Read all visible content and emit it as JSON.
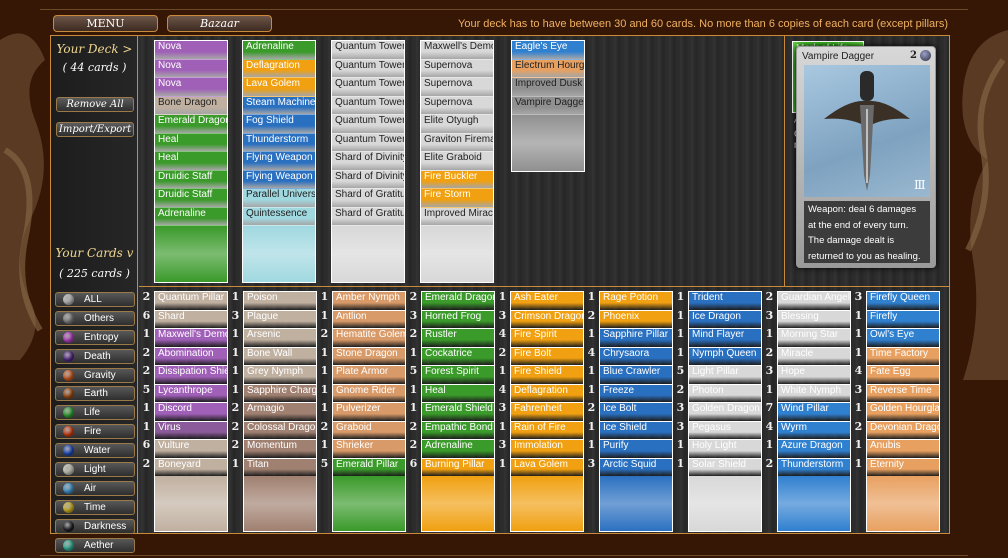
{
  "top": {
    "menu_label": "MENU",
    "bazaar_label": "Bazaar",
    "rules": "Your deck has to have between 30 and 60 cards. No more than 6 copies of each card (except pillars)"
  },
  "sidebar": {
    "deck_title": "Your Deck >",
    "deck_count": "( 44 cards )",
    "remove_all": "Remove All",
    "import_export": "Import/Export",
    "cards_title": "Your Cards v",
    "cards_count": "( 225 cards )",
    "filters": [
      {
        "label": "ALL",
        "icon": "all-icon",
        "color": "#c8c8c8"
      },
      {
        "label": "Others",
        "icon": "others-icon",
        "color": "#8a8a8a"
      },
      {
        "label": "Entropy",
        "icon": "entropy-icon",
        "color": "#c040d0"
      },
      {
        "label": "Death",
        "icon": "death-icon",
        "color": "#5a2a90"
      },
      {
        "label": "Gravity",
        "icon": "gravity-icon",
        "color": "#e06020"
      },
      {
        "label": "Earth",
        "icon": "earth-icon",
        "color": "#b05010"
      },
      {
        "label": "Life",
        "icon": "life-icon",
        "color": "#30b030"
      },
      {
        "label": "Fire",
        "icon": "fire-icon",
        "color": "#e04010"
      },
      {
        "label": "Water",
        "icon": "water-icon",
        "color": "#2050d0"
      },
      {
        "label": "Light",
        "icon": "light-icon",
        "color": "#d8d8c8"
      },
      {
        "label": "Air",
        "icon": "air-icon",
        "color": "#40a0e0"
      },
      {
        "label": "Time",
        "icon": "time-icon",
        "color": "#e0c020"
      },
      {
        "label": "Darkness",
        "icon": "darkness-icon",
        "color": "#202028"
      },
      {
        "label": "Aether",
        "icon": "aether-icon",
        "color": "#30c0a0"
      }
    ]
  },
  "element_colors": {
    "entropy": "#a060b8",
    "death": "#8a5a9a",
    "earth": "#d89a68",
    "life": "#3a9a2a",
    "fire": "#f0a010",
    "water": "#2a70c0",
    "light": "#d8d8d8",
    "air": "#3080d0",
    "time": "#e8a060",
    "other": "#c0b0a0",
    "gravity": "#a08070",
    "darkness": "#909090",
    "aether": "#a0d8e0"
  },
  "deck": {
    "columns": [
      {
        "cards": [
          {
            "name": "Nova",
            "el": "entropy"
          },
          {
            "name": "Nova",
            "el": "entropy"
          },
          {
            "name": "Nova",
            "el": "entropy"
          },
          {
            "name": "Bone Dragon",
            "el": "other"
          },
          {
            "name": "Emerald Dragon",
            "el": "life"
          },
          {
            "name": "Heal",
            "el": "life"
          },
          {
            "name": "Heal",
            "el": "life"
          },
          {
            "name": "Druidic Staff",
            "el": "life"
          },
          {
            "name": "Druidic Staff",
            "el": "life"
          },
          {
            "name": "Adrenaline",
            "el": "life"
          }
        ]
      },
      {
        "cards": [
          {
            "name": "Adrenaline",
            "el": "life"
          },
          {
            "name": "Deflagration",
            "el": "fire"
          },
          {
            "name": "Lava Golem",
            "el": "fire"
          },
          {
            "name": "Steam Machine",
            "el": "water"
          },
          {
            "name": "Fog Shield",
            "el": "water"
          },
          {
            "name": "Thunderstorm",
            "el": "water"
          },
          {
            "name": "Flying Weapon",
            "el": "water"
          },
          {
            "name": "Flying Weapon",
            "el": "water"
          },
          {
            "name": "Parallel Universe",
            "el": "aether"
          },
          {
            "name": "Quintessence",
            "el": "aether"
          }
        ]
      },
      {
        "cards": [
          {
            "name": "Quantum Tower",
            "el": "light"
          },
          {
            "name": "Quantum Tower",
            "el": "light"
          },
          {
            "name": "Quantum Tower",
            "el": "light"
          },
          {
            "name": "Quantum Tower",
            "el": "light"
          },
          {
            "name": "Quantum Tower",
            "el": "light"
          },
          {
            "name": "Quantum Tower",
            "el": "light"
          },
          {
            "name": "Shard of Divinity",
            "el": "light"
          },
          {
            "name": "Shard of Divinity",
            "el": "light"
          },
          {
            "name": "Shard of Gratitude",
            "el": "light"
          },
          {
            "name": "Shard of Gratitude",
            "el": "light"
          }
        ]
      },
      {
        "cards": [
          {
            "name": "Maxwell's Demon",
            "el": "light"
          },
          {
            "name": "Supernova",
            "el": "light"
          },
          {
            "name": "Supernova",
            "el": "light"
          },
          {
            "name": "Supernova",
            "el": "light"
          },
          {
            "name": "Elite Otyugh",
            "el": "light"
          },
          {
            "name": "Graviton Fireman",
            "el": "light"
          },
          {
            "name": "Elite Graboid",
            "el": "light"
          },
          {
            "name": "Fire Buckler",
            "el": "fire"
          },
          {
            "name": "Fire Storm",
            "el": "fire"
          },
          {
            "name": "Improved Miracle",
            "el": "light"
          }
        ]
      },
      {
        "cards": [
          {
            "name": "Eagle's Eye",
            "el": "air"
          },
          {
            "name": "Electrum Hourglass",
            "el": "time"
          },
          {
            "name": "Improved Dusk",
            "el": "darkness"
          },
          {
            "name": "Vampire Dagger",
            "el": "darkness"
          }
        ]
      }
    ]
  },
  "mark": {
    "label": "Mark of Life",
    "change_label": "^ Change mark"
  },
  "preview": {
    "name": "Vampire Dagger",
    "cost": "2",
    "description": "Weapon: deal 6 damages  at the end of every turn. The damage dealt is returned to you as healing."
  },
  "collection": {
    "columns": [
      {
        "cards": [
          {
            "count": "2",
            "name": "Quantum Pillar",
            "el": "other"
          },
          {
            "count": "6",
            "name": "Shard",
            "el": "other"
          },
          {
            "count": "1",
            "name": "Maxwell's Demon",
            "el": "entropy"
          },
          {
            "count": "2",
            "name": "Abomination",
            "el": "entropy"
          },
          {
            "count": "2",
            "name": "Dissipation Shield",
            "el": "entropy"
          },
          {
            "count": "5",
            "name": "Lycanthrope",
            "el": "entropy"
          },
          {
            "count": "1",
            "name": "Discord",
            "el": "entropy"
          },
          {
            "count": "1",
            "name": "Virus",
            "el": "death"
          },
          {
            "count": "6",
            "name": "Vulture",
            "el": "other"
          },
          {
            "count": "2",
            "name": "Boneyard",
            "el": "other"
          }
        ]
      },
      {
        "cards": [
          {
            "count": "1",
            "name": "Poison",
            "el": "other"
          },
          {
            "count": "3",
            "name": "Plague",
            "el": "other"
          },
          {
            "count": "1",
            "name": "Arsenic",
            "el": "other"
          },
          {
            "count": "1",
            "name": "Bone Wall",
            "el": "other"
          },
          {
            "count": "1",
            "name": "Grey Nymph",
            "el": "other"
          },
          {
            "count": "1",
            "name": "Sapphire Charger",
            "el": "gravity"
          },
          {
            "count": "2",
            "name": "Armagio",
            "el": "gravity"
          },
          {
            "count": "2",
            "name": "Colossal Dragon",
            "el": "gravity"
          },
          {
            "count": "2",
            "name": "Momentum",
            "el": "gravity"
          },
          {
            "count": "1",
            "name": "Titan",
            "el": "gravity"
          }
        ]
      },
      {
        "cards": [
          {
            "count": "1",
            "name": "Amber Nymph",
            "el": "earth"
          },
          {
            "count": "1",
            "name": "Antlion",
            "el": "earth"
          },
          {
            "count": "2",
            "name": "Hematite Golem",
            "el": "earth"
          },
          {
            "count": "1",
            "name": "Stone Dragon",
            "el": "earth"
          },
          {
            "count": "1",
            "name": "Plate Armor",
            "el": "earth"
          },
          {
            "count": "1",
            "name": "Gnome Rider",
            "el": "earth"
          },
          {
            "count": "1",
            "name": "Pulverizer",
            "el": "earth"
          },
          {
            "count": "2",
            "name": "Graboid",
            "el": "earth"
          },
          {
            "count": "1",
            "name": "Shrieker",
            "el": "earth"
          },
          {
            "count": "5",
            "name": "Emerald Pillar",
            "el": "life"
          }
        ]
      },
      {
        "cards": [
          {
            "count": "2",
            "name": "Emerald Dragon",
            "el": "life"
          },
          {
            "count": "3",
            "name": "Horned Frog",
            "el": "life"
          },
          {
            "count": "2",
            "name": "Rustler",
            "el": "life"
          },
          {
            "count": "1",
            "name": "Cockatrice",
            "el": "life"
          },
          {
            "count": "5",
            "name": "Forest Spirit",
            "el": "life"
          },
          {
            "count": "1",
            "name": "Heal",
            "el": "life"
          },
          {
            "count": "1",
            "name": "Emerald Shield",
            "el": "life"
          },
          {
            "count": "2",
            "name": "Empathic Bond",
            "el": "life"
          },
          {
            "count": "2",
            "name": "Adrenaline",
            "el": "life"
          },
          {
            "count": "6",
            "name": "Burning Pillar",
            "el": "fire"
          }
        ]
      },
      {
        "cards": [
          {
            "count": "1",
            "name": "Ash Eater",
            "el": "fire"
          },
          {
            "count": "3",
            "name": "Crimson Dragon",
            "el": "fire"
          },
          {
            "count": "4",
            "name": "Fire Spirit",
            "el": "fire"
          },
          {
            "count": "2",
            "name": "Fire Bolt",
            "el": "fire"
          },
          {
            "count": "1",
            "name": "Fire Shield",
            "el": "fire"
          },
          {
            "count": "4",
            "name": "Deflagration",
            "el": "fire"
          },
          {
            "count": "3",
            "name": "Fahrenheit",
            "el": "fire"
          },
          {
            "count": "1",
            "name": "Rain of Fire",
            "el": "fire"
          },
          {
            "count": "3",
            "name": "Immolation",
            "el": "fire"
          },
          {
            "count": "1",
            "name": "Lava Golem",
            "el": "fire"
          }
        ]
      },
      {
        "cards": [
          {
            "count": "1",
            "name": "Rage Potion",
            "el": "fire"
          },
          {
            "count": "2",
            "name": "Phoenix",
            "el": "fire"
          },
          {
            "count": "1",
            "name": "Sapphire Pillar",
            "el": "water"
          },
          {
            "count": "4",
            "name": "Chrysaora",
            "el": "water"
          },
          {
            "count": "1",
            "name": "Blue Crawler",
            "el": "water"
          },
          {
            "count": "1",
            "name": "Freeze",
            "el": "water"
          },
          {
            "count": "2",
            "name": "Ice Bolt",
            "el": "water"
          },
          {
            "count": "1",
            "name": "Ice Shield",
            "el": "water"
          },
          {
            "count": "1",
            "name": "Purify",
            "el": "water"
          },
          {
            "count": "3",
            "name": "Arctic Squid",
            "el": "water"
          }
        ]
      },
      {
        "cards": [
          {
            "count": "1",
            "name": "Trident",
            "el": "water"
          },
          {
            "count": "1",
            "name": "Ice Dragon",
            "el": "water"
          },
          {
            "count": "1",
            "name": "Mind Flayer",
            "el": "water"
          },
          {
            "count": "1",
            "name": "Nymph Queen",
            "el": "water"
          },
          {
            "count": "5",
            "name": "Light Pillar",
            "el": "light"
          },
          {
            "count": "2",
            "name": "Photon",
            "el": "light"
          },
          {
            "count": "3",
            "name": "Golden Dragon",
            "el": "light"
          },
          {
            "count": "3",
            "name": "Pegasus",
            "el": "light"
          },
          {
            "count": "1",
            "name": "Holy Light",
            "el": "light"
          },
          {
            "count": "1",
            "name": "Solar Shield",
            "el": "light"
          }
        ]
      },
      {
        "cards": [
          {
            "count": "2",
            "name": "Guardian Angel",
            "el": "light"
          },
          {
            "count": "3",
            "name": "Blessing",
            "el": "light"
          },
          {
            "count": "1",
            "name": "Morning Star",
            "el": "light"
          },
          {
            "count": "2",
            "name": "Miracle",
            "el": "light"
          },
          {
            "count": "3",
            "name": "Hope",
            "el": "light"
          },
          {
            "count": "1",
            "name": "White Nymph",
            "el": "light"
          },
          {
            "count": "7",
            "name": "Wind Pillar",
            "el": "air"
          },
          {
            "count": "4",
            "name": "Wyrm",
            "el": "air"
          },
          {
            "count": "1",
            "name": "Azure Dragon",
            "el": "air"
          },
          {
            "count": "2",
            "name": "Thunderstorm",
            "el": "air"
          }
        ]
      },
      {
        "cards": [
          {
            "count": "3",
            "name": "Firefly Queen",
            "el": "air"
          },
          {
            "count": "1",
            "name": "Firefly",
            "el": "air"
          },
          {
            "count": "1",
            "name": "Owl's Eye",
            "el": "air"
          },
          {
            "count": "1",
            "name": "Time Factory",
            "el": "time"
          },
          {
            "count": "4",
            "name": "Fate Egg",
            "el": "time"
          },
          {
            "count": "3",
            "name": "Reverse Time",
            "el": "time"
          },
          {
            "count": "1",
            "name": "Golden Hourglass",
            "el": "time"
          },
          {
            "count": "2",
            "name": "Devonian Dragon",
            "el": "time"
          },
          {
            "count": "1",
            "name": "Anubis",
            "el": "time"
          },
          {
            "count": "1",
            "name": "Eternity",
            "el": "time"
          }
        ]
      }
    ]
  }
}
